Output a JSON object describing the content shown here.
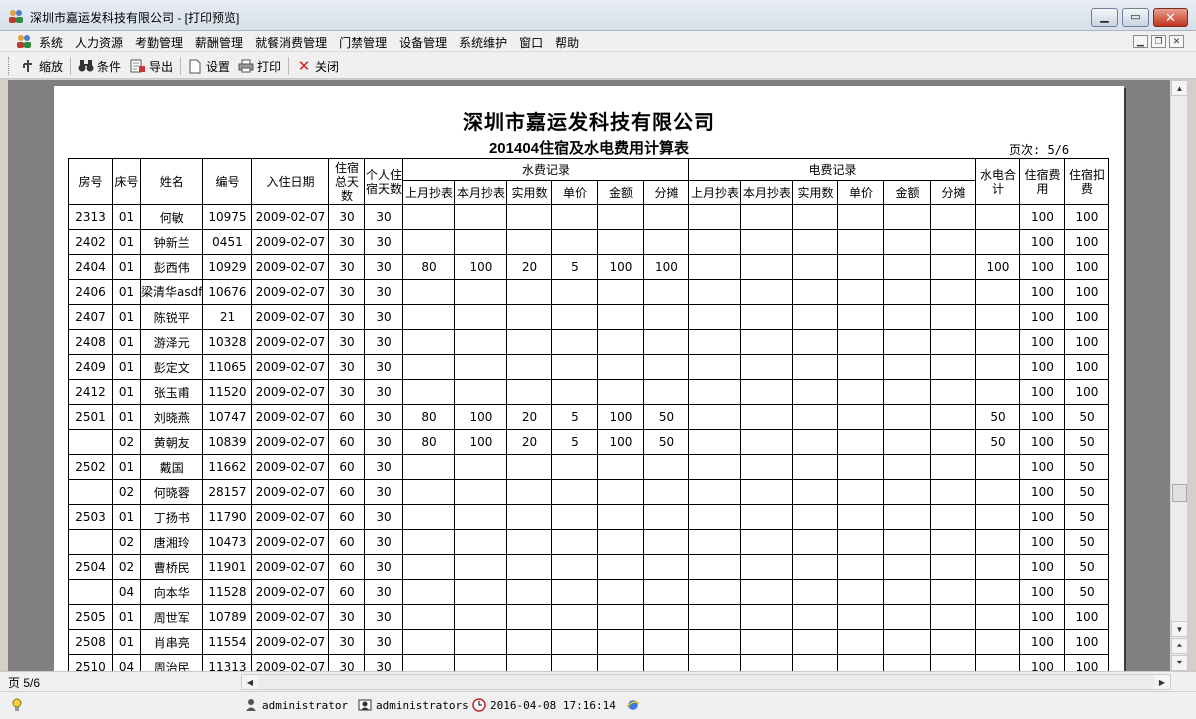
{
  "window": {
    "title": "深圳市嘉运发科技有限公司 - [打印预览]"
  },
  "menu": {
    "items": [
      "系统",
      "人力资源",
      "考勤管理",
      "薪酬管理",
      "就餐消费管理",
      "门禁管理",
      "设备管理",
      "系统维护",
      "窗口",
      "帮助"
    ]
  },
  "toolbar": {
    "zoom": "缩放",
    "condition": "条件",
    "export": "导出",
    "settings": "设置",
    "print": "打印",
    "close": "关闭"
  },
  "report": {
    "company": "深圳市嘉运发科技有限公司",
    "title": "201404住宿及水电费用计算表",
    "page": "页次: 5/6",
    "headers": {
      "room": "房号",
      "bed": "床号",
      "name": "姓名",
      "id": "编号",
      "checkin": "入住日期",
      "total_days": "住宿总天数",
      "personal_days": "个人住宿天数",
      "water_group": "水费记录",
      "electric_group": "电费记录",
      "sub": [
        "上月抄表",
        "本月抄表",
        "实用数",
        "单价",
        "金额",
        "分摊"
      ],
      "utility_total": "水电合计",
      "lodging_fee": "住宿费用",
      "lodging_deduct": "住宿扣费"
    },
    "rows": [
      {
        "room": "2313",
        "bed": "01",
        "name": "何敏",
        "id": "10975",
        "date": "2009-02-07",
        "total": "30",
        "personal": "30",
        "water": [
          "",
          "",
          "",
          "",
          "",
          ""
        ],
        "elec": [
          "",
          "",
          "",
          "",
          "",
          ""
        ],
        "util": "",
        "fee": "100",
        "deduct": "100"
      },
      {
        "room": "2402",
        "bed": "01",
        "name": "钟新兰",
        "id": "0451",
        "date": "2009-02-07",
        "total": "30",
        "personal": "30",
        "water": [
          "",
          "",
          "",
          "",
          "",
          ""
        ],
        "elec": [
          "",
          "",
          "",
          "",
          "",
          ""
        ],
        "util": "",
        "fee": "100",
        "deduct": "100"
      },
      {
        "room": "2404",
        "bed": "01",
        "name": "彭西伟",
        "id": "10929",
        "date": "2009-02-07",
        "total": "30",
        "personal": "30",
        "water": [
          "80",
          "100",
          "20",
          "5",
          "100",
          "100"
        ],
        "elec": [
          "",
          "",
          "",
          "",
          "",
          ""
        ],
        "util": "100",
        "fee": "100",
        "deduct": "100"
      },
      {
        "room": "2406",
        "bed": "01",
        "name": "梁清华asdf",
        "id": "10676",
        "date": "2009-02-07",
        "total": "30",
        "personal": "30",
        "water": [
          "",
          "",
          "",
          "",
          "",
          ""
        ],
        "elec": [
          "",
          "",
          "",
          "",
          "",
          ""
        ],
        "util": "",
        "fee": "100",
        "deduct": "100"
      },
      {
        "room": "2407",
        "bed": "01",
        "name": "陈锐平",
        "id": "21",
        "date": "2009-02-07",
        "total": "30",
        "personal": "30",
        "water": [
          "",
          "",
          "",
          "",
          "",
          ""
        ],
        "elec": [
          "",
          "",
          "",
          "",
          "",
          ""
        ],
        "util": "",
        "fee": "100",
        "deduct": "100"
      },
      {
        "room": "2408",
        "bed": "01",
        "name": "游泽元",
        "id": "10328",
        "date": "2009-02-07",
        "total": "30",
        "personal": "30",
        "water": [
          "",
          "",
          "",
          "",
          "",
          ""
        ],
        "elec": [
          "",
          "",
          "",
          "",
          "",
          ""
        ],
        "util": "",
        "fee": "100",
        "deduct": "100"
      },
      {
        "room": "2409",
        "bed": "01",
        "name": "彭定文",
        "id": "11065",
        "date": "2009-02-07",
        "total": "30",
        "personal": "30",
        "water": [
          "",
          "",
          "",
          "",
          "",
          ""
        ],
        "elec": [
          "",
          "",
          "",
          "",
          "",
          ""
        ],
        "util": "",
        "fee": "100",
        "deduct": "100"
      },
      {
        "room": "2412",
        "bed": "01",
        "name": "张玉甫",
        "id": "11520",
        "date": "2009-02-07",
        "total": "30",
        "personal": "30",
        "water": [
          "",
          "",
          "",
          "",
          "",
          ""
        ],
        "elec": [
          "",
          "",
          "",
          "",
          "",
          ""
        ],
        "util": "",
        "fee": "100",
        "deduct": "100"
      },
      {
        "room": "2501",
        "bed": "01",
        "name": "刘晓燕",
        "id": "10747",
        "date": "2009-02-07",
        "total": "60",
        "personal": "30",
        "water": [
          "80",
          "100",
          "20",
          "5",
          "100",
          "50"
        ],
        "elec": [
          "",
          "",
          "",
          "",
          "",
          ""
        ],
        "util": "50",
        "fee": "100",
        "deduct": "50"
      },
      {
        "room": "",
        "bed": "02",
        "name": "黄朝友",
        "id": "10839",
        "date": "2009-02-07",
        "total": "60",
        "personal": "30",
        "water": [
          "80",
          "100",
          "20",
          "5",
          "100",
          "50"
        ],
        "elec": [
          "",
          "",
          "",
          "",
          "",
          ""
        ],
        "util": "50",
        "fee": "100",
        "deduct": "50"
      },
      {
        "room": "2502",
        "bed": "01",
        "name": "戴国",
        "id": "11662",
        "date": "2009-02-07",
        "total": "60",
        "personal": "30",
        "water": [
          "",
          "",
          "",
          "",
          "",
          ""
        ],
        "elec": [
          "",
          "",
          "",
          "",
          "",
          ""
        ],
        "util": "",
        "fee": "100",
        "deduct": "50"
      },
      {
        "room": "",
        "bed": "02",
        "name": "何晓蓉",
        "id": "28157",
        "date": "2009-02-07",
        "total": "60",
        "personal": "30",
        "water": [
          "",
          "",
          "",
          "",
          "",
          ""
        ],
        "elec": [
          "",
          "",
          "",
          "",
          "",
          ""
        ],
        "util": "",
        "fee": "100",
        "deduct": "50"
      },
      {
        "room": "2503",
        "bed": "01",
        "name": "丁扬书",
        "id": "11790",
        "date": "2009-02-07",
        "total": "60",
        "personal": "30",
        "water": [
          "",
          "",
          "",
          "",
          "",
          ""
        ],
        "elec": [
          "",
          "",
          "",
          "",
          "",
          ""
        ],
        "util": "",
        "fee": "100",
        "deduct": "50"
      },
      {
        "room": "",
        "bed": "02",
        "name": "唐湘玲",
        "id": "10473",
        "date": "2009-02-07",
        "total": "60",
        "personal": "30",
        "water": [
          "",
          "",
          "",
          "",
          "",
          ""
        ],
        "elec": [
          "",
          "",
          "",
          "",
          "",
          ""
        ],
        "util": "",
        "fee": "100",
        "deduct": "50"
      },
      {
        "room": "2504",
        "bed": "02",
        "name": "曹桥民",
        "id": "11901",
        "date": "2009-02-07",
        "total": "60",
        "personal": "30",
        "water": [
          "",
          "",
          "",
          "",
          "",
          ""
        ],
        "elec": [
          "",
          "",
          "",
          "",
          "",
          ""
        ],
        "util": "",
        "fee": "100",
        "deduct": "50"
      },
      {
        "room": "",
        "bed": "04",
        "name": "向本华",
        "id": "11528",
        "date": "2009-02-07",
        "total": "60",
        "personal": "30",
        "water": [
          "",
          "",
          "",
          "",
          "",
          ""
        ],
        "elec": [
          "",
          "",
          "",
          "",
          "",
          ""
        ],
        "util": "",
        "fee": "100",
        "deduct": "50"
      },
      {
        "room": "2505",
        "bed": "01",
        "name": "周世军",
        "id": "10789",
        "date": "2009-02-07",
        "total": "30",
        "personal": "30",
        "water": [
          "",
          "",
          "",
          "",
          "",
          ""
        ],
        "elec": [
          "",
          "",
          "",
          "",
          "",
          ""
        ],
        "util": "",
        "fee": "100",
        "deduct": "100"
      },
      {
        "room": "2508",
        "bed": "01",
        "name": "肖串亮",
        "id": "11554",
        "date": "2009-02-07",
        "total": "30",
        "personal": "30",
        "water": [
          "",
          "",
          "",
          "",
          "",
          ""
        ],
        "elec": [
          "",
          "",
          "",
          "",
          "",
          ""
        ],
        "util": "",
        "fee": "100",
        "deduct": "100"
      },
      {
        "room": "2510",
        "bed": "04",
        "name": "周治民",
        "id": "11313",
        "date": "2009-02-07",
        "total": "30",
        "personal": "30",
        "water": [
          "",
          "",
          "",
          "",
          "",
          ""
        ],
        "elec": [
          "",
          "",
          "",
          "",
          "",
          ""
        ],
        "util": "",
        "fee": "100",
        "deduct": "100"
      }
    ]
  },
  "pagebar": {
    "page_label": "页 5/6"
  },
  "status": {
    "user": "administrator",
    "group": "administrators",
    "datetime": "2016-04-08 17:16:14"
  }
}
